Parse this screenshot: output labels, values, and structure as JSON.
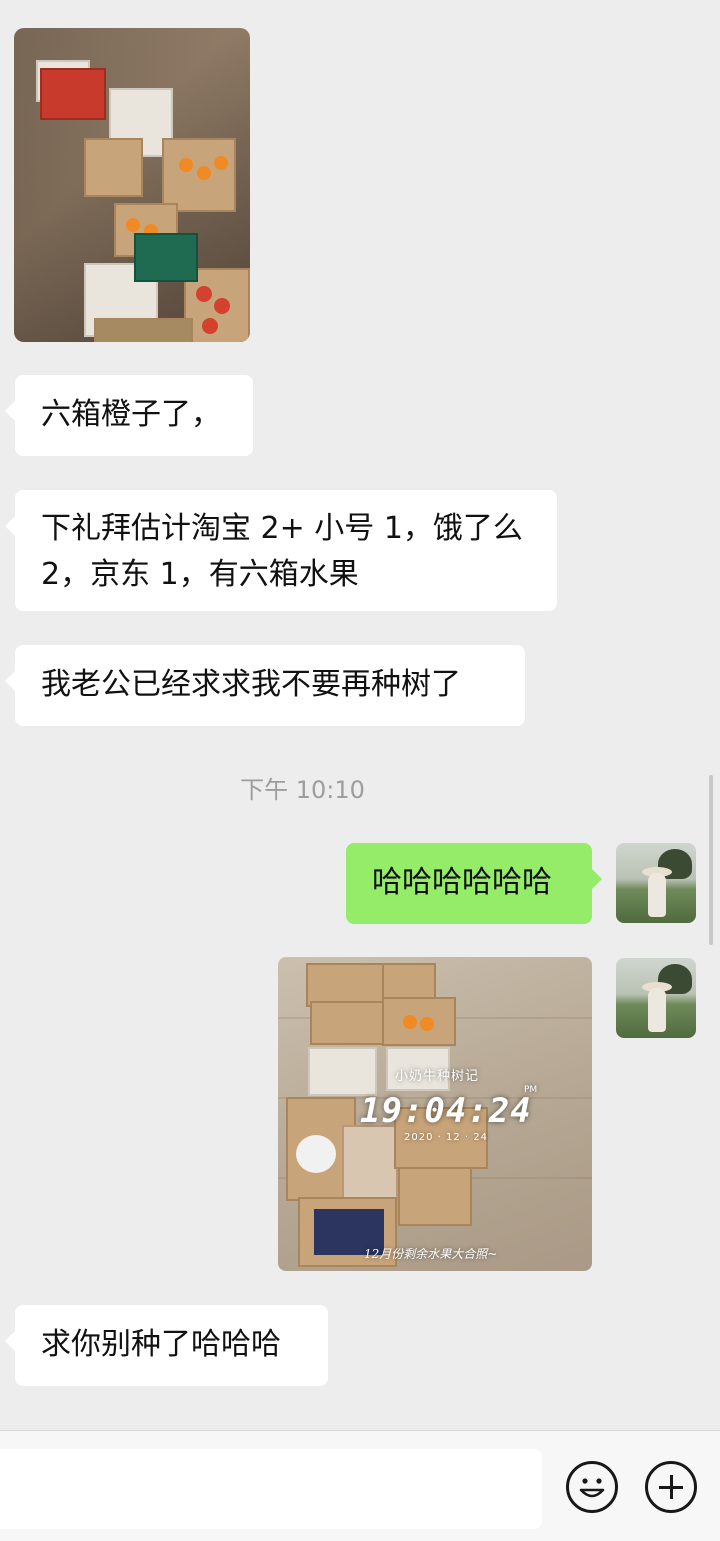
{
  "messages": [
    {
      "id": "m1",
      "side": "left",
      "type": "image",
      "icon": "fruit-boxes-photo"
    },
    {
      "id": "m2",
      "side": "left",
      "type": "text",
      "text": "六箱橙子了，"
    },
    {
      "id": "m3",
      "side": "left",
      "type": "text",
      "line1": "下礼拜估计淘宝 2+ 小号 1，饿了么",
      "line2": "2，京东 1，有六箱水果"
    },
    {
      "id": "m4",
      "side": "left",
      "type": "text",
      "text": "我老公已经求求我不要再种树了"
    },
    {
      "id": "t1",
      "type": "timestamp",
      "text": "下午 10:10"
    },
    {
      "id": "m5",
      "side": "right",
      "type": "text",
      "text": "哈哈哈哈哈哈"
    },
    {
      "id": "m6",
      "side": "right",
      "type": "image",
      "overlay": {
        "name": "小奶牛种树记",
        "period": "PM",
        "clock": "19:04:24",
        "date": "2020 · 12 · 24",
        "caption": "12月份剩余水果大合照~"
      }
    },
    {
      "id": "m7",
      "side": "left",
      "type": "text",
      "text": "求你别种了哈哈哈"
    }
  ],
  "input_bar": {
    "text_value": "",
    "emoji_icon": "smiley-icon",
    "plus_icon": "plus-icon"
  },
  "colors": {
    "background": "#ededed",
    "incoming_bubble": "#ffffff",
    "outgoing_bubble": "#95ec69",
    "timestamp_text": "#9d9d9d"
  }
}
